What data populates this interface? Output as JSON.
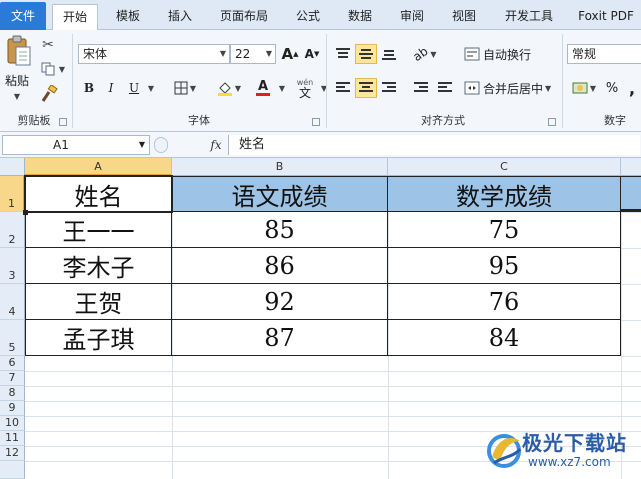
{
  "ribbon_tabs": [
    "文件",
    "开始",
    "模板",
    "插入",
    "页面布局",
    "公式",
    "数据",
    "审阅",
    "视图",
    "开发工具",
    "Foxit PDF"
  ],
  "clipboard": {
    "paste_label": "粘贴",
    "group_label": "剪贴板"
  },
  "font": {
    "name": "宋体",
    "size": "22",
    "bold": "B",
    "italic": "I",
    "underline": "U",
    "grow": "A",
    "shrink": "A",
    "color_letter": "A",
    "wen": "文",
    "group_label": "字体"
  },
  "alignment": {
    "wrap_label": "自动换行",
    "merge_label": "合并后居中",
    "group_label": "对齐方式"
  },
  "number": {
    "format": "常规",
    "percent": "%",
    "comma": ",",
    "group_label": "数字"
  },
  "formula_bar": {
    "cell_ref": "A1",
    "fx": "fx",
    "value": "姓名"
  },
  "columns": [
    "A",
    "B",
    "C"
  ],
  "rows": [
    "1",
    "2",
    "3",
    "4",
    "5",
    "6",
    "7",
    "8",
    "9",
    "10",
    "11",
    "12"
  ],
  "table": {
    "headers": [
      "姓名",
      "语文成绩",
      "数学成绩"
    ],
    "rows": [
      [
        "王一一",
        "85",
        "75"
      ],
      [
        "李木子",
        "86",
        "95"
      ],
      [
        "王贺",
        "92",
        "76"
      ],
      [
        "孟子琪",
        "87",
        "84"
      ]
    ]
  },
  "watermark": {
    "title": "极光下载站",
    "url": "www.xz7.com"
  },
  "colors": {
    "file_tab": "#2a7ad8",
    "header_fill": "#9dc3e6",
    "selection": "#f8d68a",
    "highlight": "#fde69b"
  }
}
